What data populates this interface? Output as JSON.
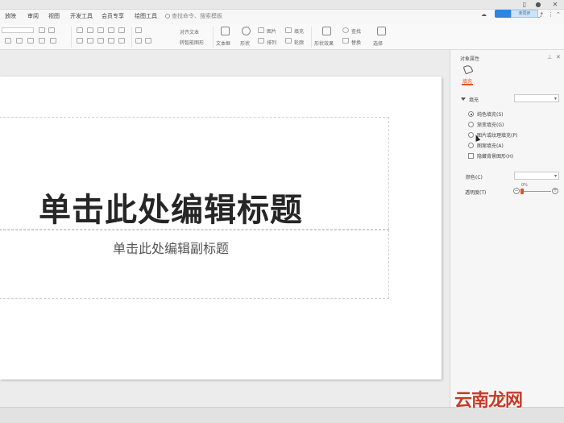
{
  "menu": {
    "tabs": [
      "放映",
      "审阅",
      "视图",
      "开发工具",
      "会员专享",
      "绘图工具"
    ],
    "search_placeholder": "查找命令、搜索模板"
  },
  "window": {
    "cloud_tip": "未同步"
  },
  "ribbon": {
    "text_box": "文本框",
    "shape": "形状",
    "picture": "图片",
    "fill": "填充",
    "find": "查找",
    "arrange": "排列",
    "outline": "轮廓",
    "shape_effect": "形状效果",
    "select": "选择",
    "replace": "替换",
    "align_text": "对齐文本",
    "smart_convert": "转智能图形"
  },
  "slide": {
    "title": "单击此处编辑标题",
    "subtitle": "单击此处编辑副标题"
  },
  "pane": {
    "title": "对象属性",
    "tab_fill": "填充",
    "section": "填充",
    "options": [
      {
        "label": "纯色填充(S)",
        "type": "radio",
        "checked": true
      },
      {
        "label": "渐变填充(G)",
        "type": "radio",
        "checked": false
      },
      {
        "label": "图片或纹理填充(P)",
        "type": "radio",
        "checked": false
      },
      {
        "label": "图案填充(A)",
        "type": "radio",
        "checked": false
      },
      {
        "label": "隐藏背景图形(H)",
        "type": "checkbox",
        "checked": false
      }
    ],
    "color_label": "颜色(C)",
    "transparency_label": "透明度(T)",
    "transparency_value": "0%",
    "transparency_fraction": 0
  },
  "watermark": "云南龙网",
  "colors": {
    "accent": "#e0551f",
    "watermark": "#c53a2a"
  }
}
